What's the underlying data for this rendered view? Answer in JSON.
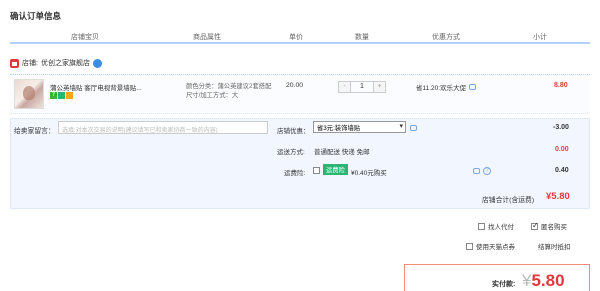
{
  "page_title": "确认订单信息",
  "columns": [
    "店铺宝贝",
    "商品属性",
    "单价",
    "数量",
    "优惠方式",
    "小计"
  ],
  "shop": {
    "label": "店铺:",
    "name": "优创之家旗舰店"
  },
  "item": {
    "name": "蒲公英墙贴 客厅电视背景墙贴...",
    "badges": [
      {
        "text": "7",
        "color": "#3bb33b"
      },
      {
        "text": "",
        "color": "#2bb573"
      },
      {
        "text": "",
        "color": "#f5a623"
      }
    ],
    "attr_color": "颜色分类：蒲公英建议2套搭配",
    "attr_size": "尺寸/加工方式：大",
    "price": "20.00",
    "quantity": "1",
    "qty_minus": "-",
    "qty_plus": "+",
    "promo": "省11.20:欢乐大促",
    "subtotal": "8.80"
  },
  "message": {
    "label": "给卖家留言：",
    "placeholder": "选填:对本次交易的说明(建议填写已和卖家协商一致的内容)"
  },
  "shop_discount": {
    "label": "店铺优惠：",
    "selected": "省3元:装饰墙贴",
    "value": "-3.00"
  },
  "shipping": {
    "label": "运送方式:",
    "text": "普通配送 快递 免邮",
    "value": "0.00"
  },
  "insurance": {
    "label": "运费险:",
    "badge": "运费险",
    "text": "¥0.40元购买",
    "value": "0.40"
  },
  "shop_total": {
    "label": "店铺合计(含运费)",
    "value": "¥5.80"
  },
  "options": {
    "proxy_pay": "找人代付",
    "anonymous": "匿名购买",
    "tmall_points": "使用天猫点券",
    "settle_note": "结算时抵扣"
  },
  "final": {
    "label": "实付款:",
    "currency": "¥",
    "amount": "5.80"
  },
  "colors": {
    "accent": "#e4393c",
    "header_border": "#b2d1ff",
    "panel_bg": "#f2f7ff"
  }
}
